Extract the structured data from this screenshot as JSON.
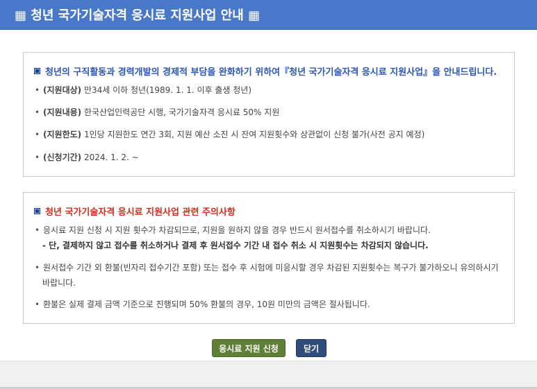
{
  "window": {
    "title": "▦ 청년 국가기술자격 응시료 지원사업 안내 ▦"
  },
  "info_panel": {
    "headline": "청년의 구직활동과 경력개발의 경제적 부담을 완화하기 위하여『청년 국가기술자격 응시료 지원사업』을 안내드립니다.",
    "items": [
      {
        "label": "(지원대상)",
        "text": " 만34세 이하 청년(1989. 1. 1. 이후 출생 청년)"
      },
      {
        "label": "(지원내용)",
        "text": " 한국산업인력공단 시행, 국가기술자격 응시료 50% 지원"
      },
      {
        "label": "(지원한도)",
        "text": " 1인당 지원한도 연간 3회, 지원 예산 소진 시 잔여 지원횟수와 상관없이 신청 불가(사전 공지 예정)"
      },
      {
        "label": "(신청기간)",
        "text": " 2024. 1. 2. ~"
      }
    ]
  },
  "notice_panel": {
    "headline": "청년 국가기술자격 응시료 지원사업 관련 주의사항",
    "items": [
      {
        "text": "응시료 지원 신청 시 지원 횟수가 차감되므로, 지원을 원하지 않을 경우 반드시 원서접수를 취소하시기 바랍니다.",
        "sub": "- 단, 결제하지 않고 접수를 취소하거나 결제 후 원서접수 기간 내 접수 취소 시 지원횟수는 차감되지 않습니다."
      },
      {
        "text": "원서접수 기간 외 환불(빈자리 접수기간 포함) 또는 접수 후 시험에 미응시할 경우 차감된 지원횟수는 복구가 불가하오니 유의하시기",
        "cont": "바랍니다."
      },
      {
        "text": "환불은 실제 결제 금액 기준으로 진행되며 50% 환불의 경우, 10원 미만의 금액은 절사됩니다."
      }
    ]
  },
  "buttons": {
    "apply": "응시료 지원 신청",
    "close": "닫기"
  },
  "bullet": "•",
  "colors": {
    "titlebar": "#4a78c8",
    "info_headline": "#2a56b8",
    "notice_headline": "#d12d1c",
    "apply_button": "#5f7f36",
    "close_button": "#2f4c7a"
  }
}
